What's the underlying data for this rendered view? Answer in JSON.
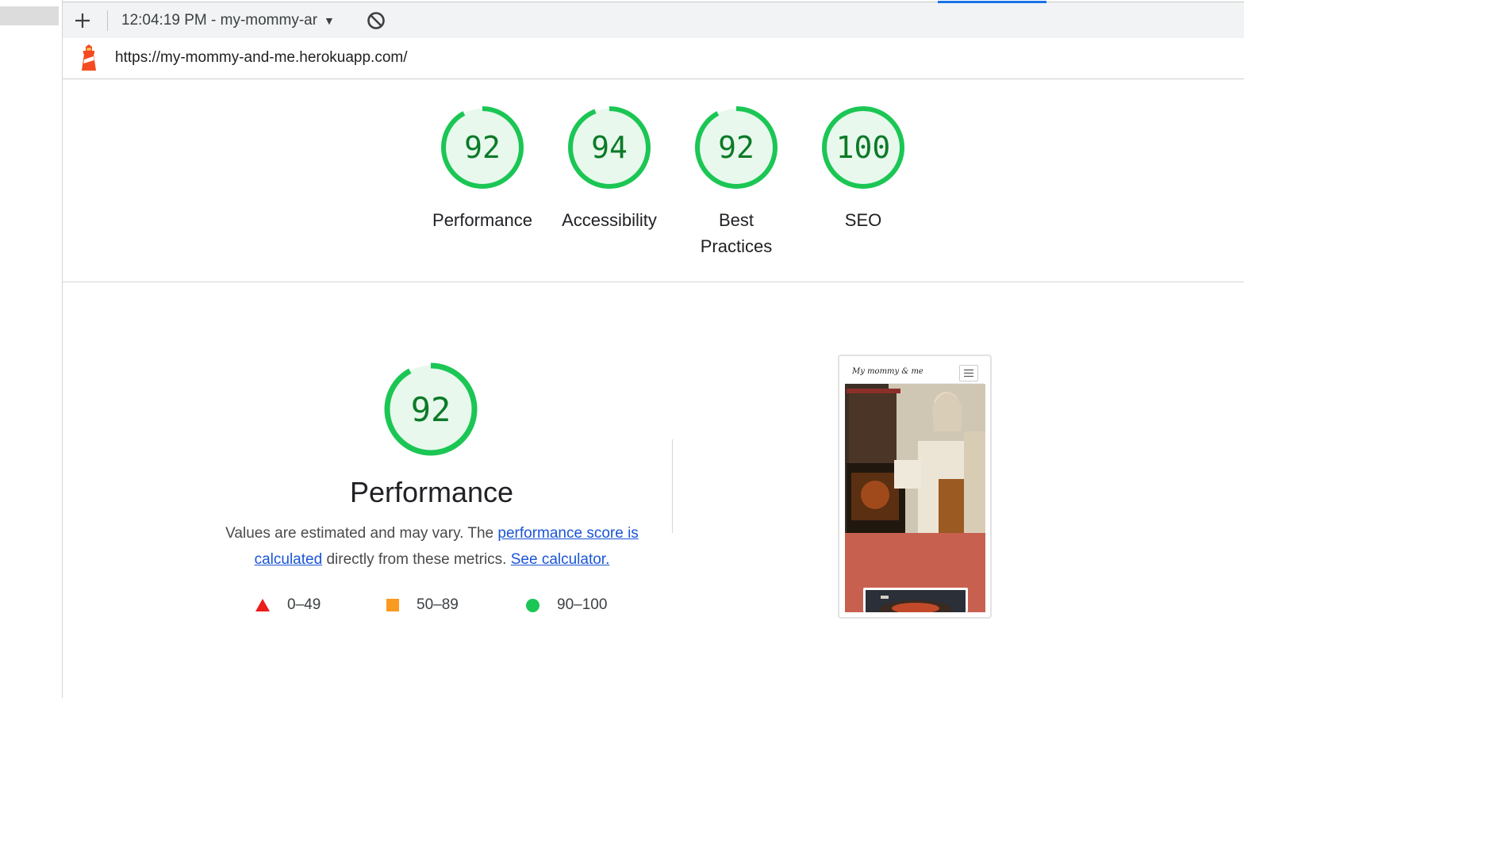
{
  "toolbar": {
    "report_select_label": "12:04:19 PM - my-mommy-ar",
    "add_icon": "plus-icon",
    "caret_icon": "dropdown-triangle-icon",
    "clear_icon": "block-icon"
  },
  "urlbar": {
    "logo_icon": "lighthouse-icon",
    "url": "https://my-mommy-and-me.herokuapp.com/"
  },
  "gauges": [
    {
      "label": "Performance",
      "score": "92",
      "value": 92
    },
    {
      "label": "Accessibility",
      "score": "94",
      "value": 94
    },
    {
      "label": "Best Practices",
      "score": "92",
      "value": 92
    },
    {
      "label": "SEO",
      "score": "100",
      "value": 100
    }
  ],
  "performance": {
    "score": "92",
    "value": 92,
    "title": "Performance",
    "desc_prefix": "Values are estimated and may vary. The ",
    "score_link": "performance score is calculated",
    "desc_middle": " directly from these metrics. ",
    "calculator_link": "See calculator."
  },
  "legend": [
    {
      "icon": "triangle-icon",
      "label": "0–49",
      "color": "#eb1d1d"
    },
    {
      "icon": "square-icon",
      "label": "50–89",
      "color": "#fa9b21"
    },
    {
      "icon": "circle-icon",
      "label": "90–100",
      "color": "#1bc654"
    }
  ],
  "screenshot": {
    "brand": "My mommy & me",
    "menu_icon": "hamburger-icon"
  },
  "colors": {
    "pass_ring": "#1bc654",
    "pass_fill": "#e8f8ed",
    "pass_text": "#0c7a28",
    "link": "#1a55d6",
    "accent_bar": "#1a73e8"
  }
}
